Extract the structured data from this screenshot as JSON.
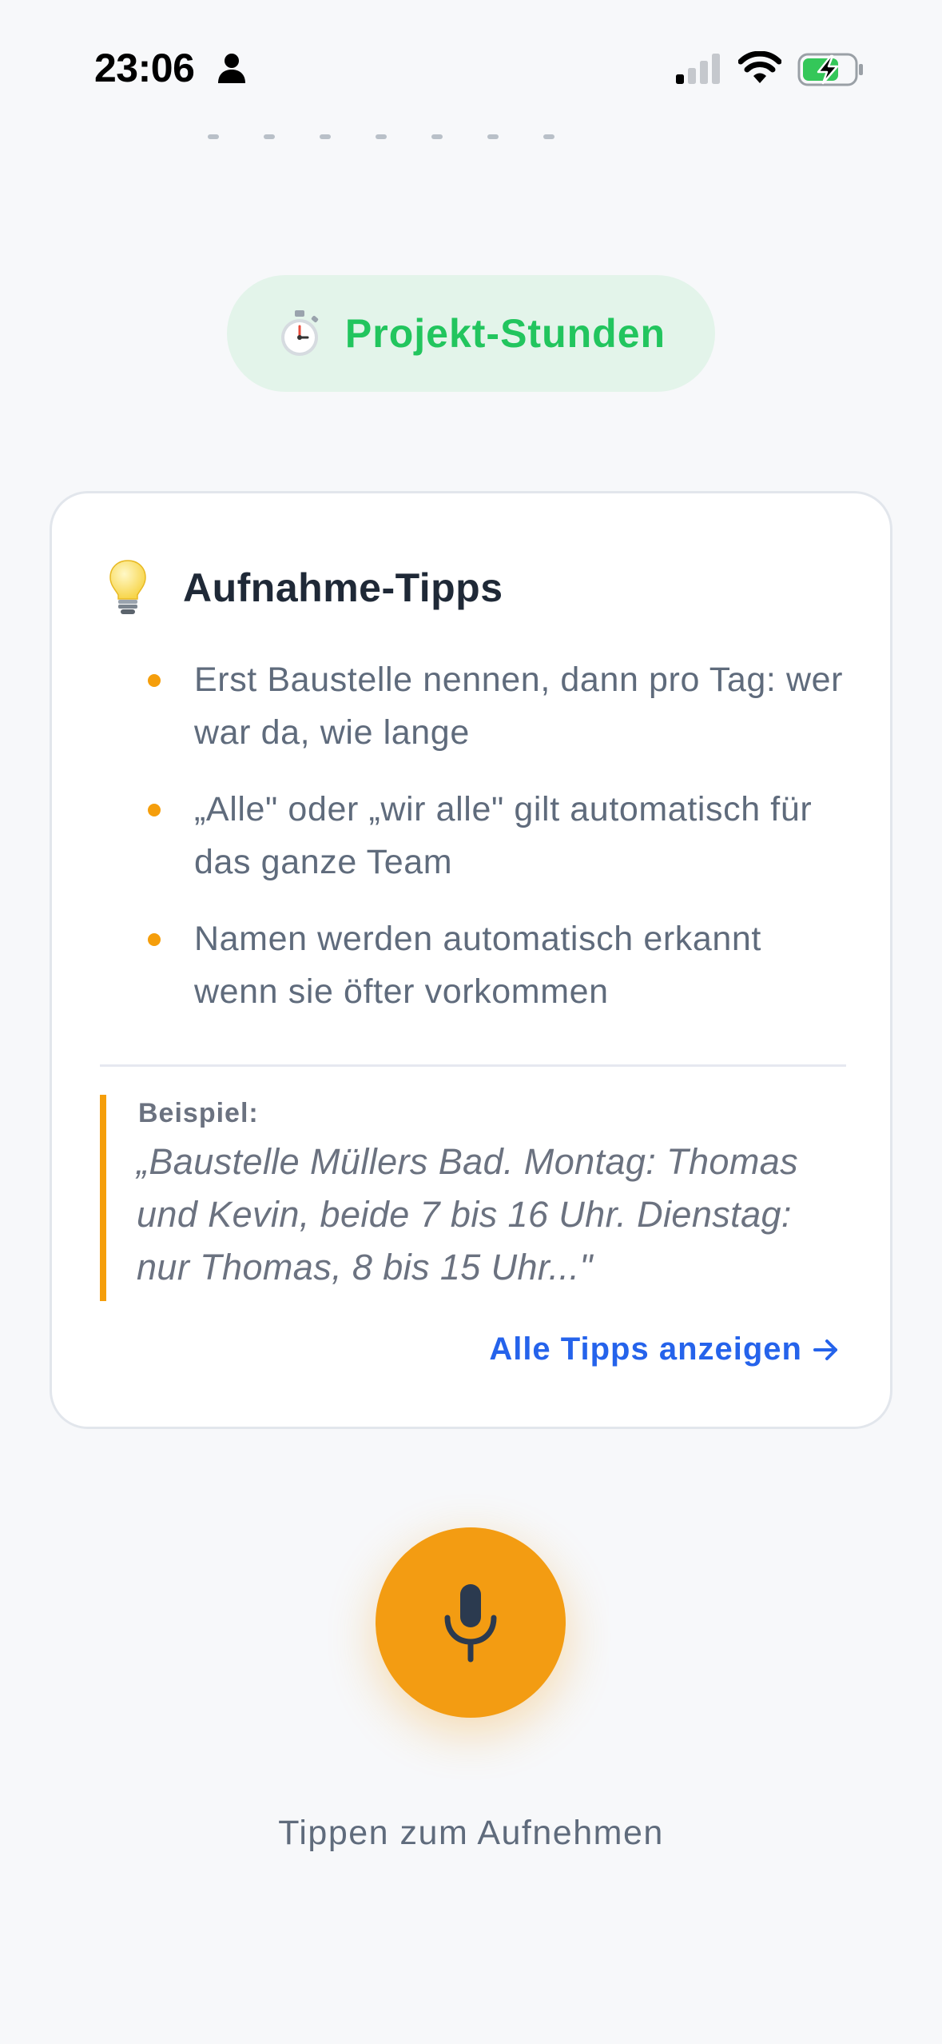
{
  "status_bar": {
    "time": "23:06",
    "icons": [
      "person-icon",
      "cellular-signal-icon",
      "wifi-icon",
      "battery-charging-icon"
    ]
  },
  "mode_chip": {
    "icon": "stopwatch-icon",
    "label": "Projekt-Stunden",
    "color": "#22c55e",
    "background": "#e3f4ea"
  },
  "tips_card": {
    "icon": "lightbulb-icon",
    "title": "Aufnahme-Tipps",
    "tips": [
      "Erst Baustelle nennen, dann pro Tag: wer war da, wie lange",
      "„Alle\" oder „wir alle\" gilt automatisch für das ganze Team",
      "Namen werden automatisch erkannt wenn sie öfter vorkommen"
    ],
    "example_label": "Beispiel:",
    "example_quote": "„Baustelle Müllers Bad. Montag: Thomas und Kevin, beide 7 bis 16 Uhr. Dienstag: nur Thomas, 8 bis 15 Uhr...\"",
    "link_label": "Alle Tipps anzeigen",
    "link_icon": "arrow-right-icon",
    "accent_color": "#f59e0b",
    "link_color": "#2563eb"
  },
  "recorder": {
    "icon": "microphone-icon",
    "button_color": "#f39c12",
    "hint": "Tippen zum Aufnehmen"
  }
}
